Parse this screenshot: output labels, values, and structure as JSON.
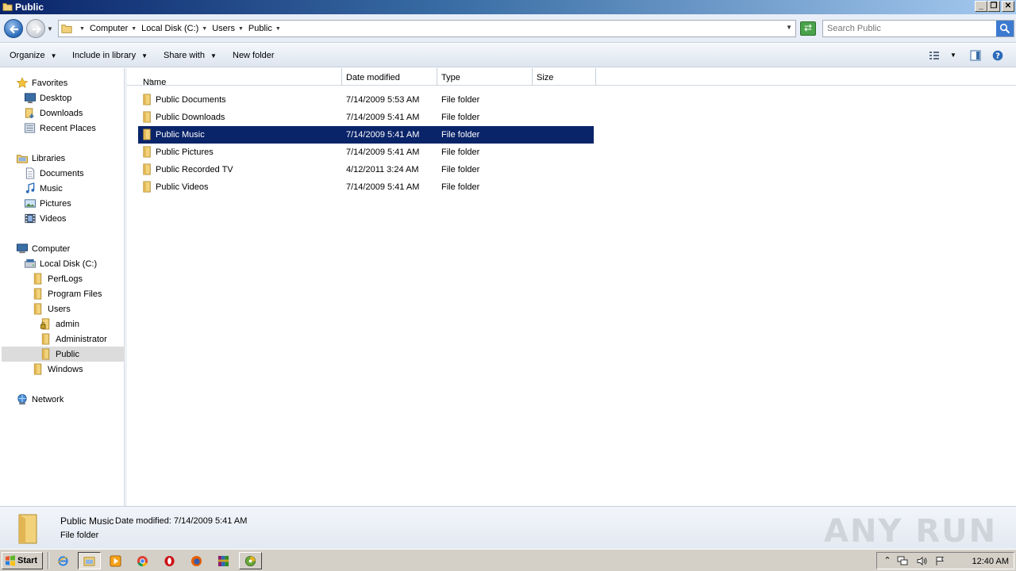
{
  "window": {
    "title": "Public"
  },
  "address": {
    "crumbs": [
      "Computer",
      "Local Disk (C:)",
      "Users",
      "Public"
    ]
  },
  "search": {
    "value": "",
    "placeholder": "Search Public"
  },
  "toolbar": {
    "organize": "Organize",
    "include_in_library": "Include in library",
    "share_with": "Share with",
    "new_folder": "New folder"
  },
  "nav": {
    "favorites": "Favorites",
    "desktop": "Desktop",
    "downloads": "Downloads",
    "recent_places": "Recent Places",
    "libraries": "Libraries",
    "documents": "Documents",
    "music": "Music",
    "pictures": "Pictures",
    "videos": "Videos",
    "computer": "Computer",
    "local_disk": "Local Disk (C:)",
    "perflogs": "PerfLogs",
    "program_files": "Program Files",
    "users": "Users",
    "admin": "admin",
    "administrator": "Administrator",
    "public": "Public",
    "windows": "Windows",
    "network": "Network"
  },
  "columns": {
    "name": "Name",
    "date_modified": "Date modified",
    "type": "Type",
    "size": "Size"
  },
  "files": [
    {
      "name": "Public Documents",
      "date": "7/14/2009 5:53 AM",
      "type": "File folder",
      "size": ""
    },
    {
      "name": "Public Downloads",
      "date": "7/14/2009 5:41 AM",
      "type": "File folder",
      "size": ""
    },
    {
      "name": "Public Music",
      "date": "7/14/2009 5:41 AM",
      "type": "File folder",
      "size": ""
    },
    {
      "name": "Public Pictures",
      "date": "7/14/2009 5:41 AM",
      "type": "File folder",
      "size": ""
    },
    {
      "name": "Public Recorded TV",
      "date": "4/12/2011 3:24 AM",
      "type": "File folder",
      "size": ""
    },
    {
      "name": "Public Videos",
      "date": "7/14/2009 5:41 AM",
      "type": "File folder",
      "size": ""
    }
  ],
  "selected_file": "Public Music",
  "details": {
    "name": "Public Music",
    "date_label": "Date modified:",
    "date_value": "7/14/2009 5:41 AM",
    "type": "File folder",
    "watermark": "ANY RUN"
  },
  "taskbar": {
    "start": "Start",
    "clock": "12:40 AM"
  },
  "colors": {
    "selection": "#0a246a",
    "title_start": "#0a246a",
    "title_end": "#a6caf0",
    "folder": "#e8c25a"
  }
}
